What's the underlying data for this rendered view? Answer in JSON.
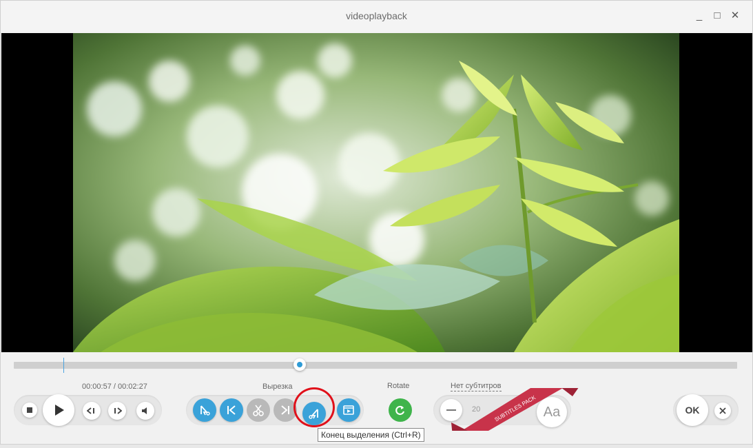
{
  "window": {
    "title": "videoplayback"
  },
  "player": {
    "time": "00:00:57 / 00:02:27",
    "progress": 0.395
  },
  "cut": {
    "label": "Вырезка"
  },
  "rotate": {
    "label": "Rotate"
  },
  "subtitles": {
    "label": "Нет субтитров",
    "size": "20",
    "pack_label": "SUBTITLES PACK",
    "font_button": "Aa"
  },
  "actions": {
    "ok_label": "OK"
  },
  "tooltip": {
    "text": "Конец выделения (Ctrl+R)"
  },
  "colors": {
    "accent": "#3aa2d9",
    "rotate": "#3fb44b",
    "ribbon": "#c8334a",
    "highlight": "#e0101a"
  }
}
